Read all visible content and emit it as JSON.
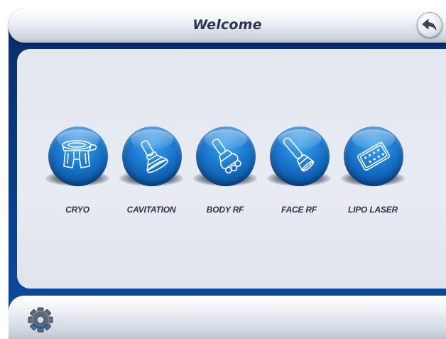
{
  "header": {
    "title": "Welcome",
    "back_icon": "back-arrow-icon"
  },
  "menu": {
    "items": [
      {
        "label": "CRYO",
        "icon": "cryo-handpiece-icon"
      },
      {
        "label": "CAVITATION",
        "icon": "cavitation-probe-icon"
      },
      {
        "label": "BODY RF",
        "icon": "body-rf-handpiece-icon"
      },
      {
        "label": "FACE RF",
        "icon": "face-rf-probe-icon"
      },
      {
        "label": "LIPO LASER",
        "icon": "lipo-laser-pad-icon"
      }
    ]
  },
  "footer": {
    "settings_icon": "gear-icon"
  },
  "colors": {
    "frame_blue": "#0a3a82",
    "orb_blue": "#1d7bd0",
    "panel_gray": "#e3e8ef",
    "label_text": "#2b3447"
  }
}
